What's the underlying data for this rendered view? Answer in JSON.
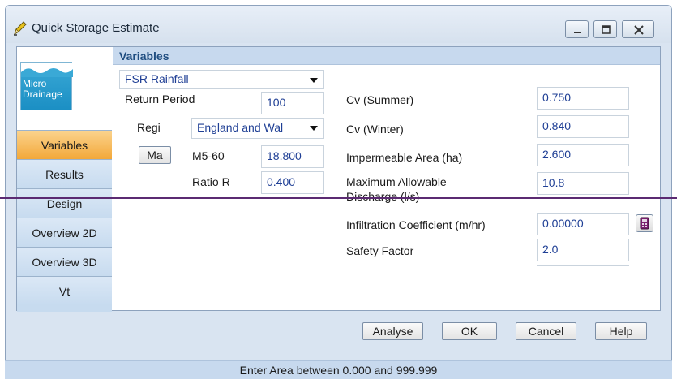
{
  "window": {
    "title": "Quick Storage Estimate"
  },
  "logo": {
    "text_line1": "Micro",
    "text_line2": "Drainage"
  },
  "nav": {
    "items": [
      {
        "label": "Variables",
        "active": true
      },
      {
        "label": "Results"
      },
      {
        "label": "Design"
      },
      {
        "label": "Overview 2D"
      },
      {
        "label": "Overview 3D"
      },
      {
        "label": "Vt"
      }
    ]
  },
  "panel": {
    "header": "Variables"
  },
  "rainfall": {
    "type_select": "FSR Rainfall",
    "return_period_label": "Return Period",
    "return_period_value": "100",
    "region_label": "Regi",
    "region_value": "England and Wal",
    "map_button": "Ma",
    "m5_60_label": "M5-60",
    "m5_60_value": "18.800",
    "ratio_r_label": "Ratio R",
    "ratio_r_value": "0.400"
  },
  "params": {
    "cv_summer_label": "Cv (Summer)",
    "cv_summer_value": "0.750",
    "cv_winter_label": "Cv (Winter)",
    "cv_winter_value": "0.840",
    "impermeable_label": "Impermeable Area (ha)",
    "impermeable_value": "2.600",
    "max_discharge_label_1": "Maximum Allowable",
    "max_discharge_label_2": "Discharge (l/s)",
    "max_discharge_value": "10.8",
    "infiltration_label": "Infiltration Coefficient (m/hr)",
    "infiltration_value": "0.00000",
    "safety_label": "Safety Factor",
    "safety_value": "2.0"
  },
  "buttons": {
    "analyse": "Analyse",
    "ok": "OK",
    "cancel": "Cancel",
    "help": "Help"
  },
  "status": {
    "text": "Enter Area between 0.000 and 999.999"
  },
  "colors": {
    "accent_active_tab": "#f3a839",
    "value_text": "#1f3f95",
    "header_text": "#1f4d80"
  }
}
